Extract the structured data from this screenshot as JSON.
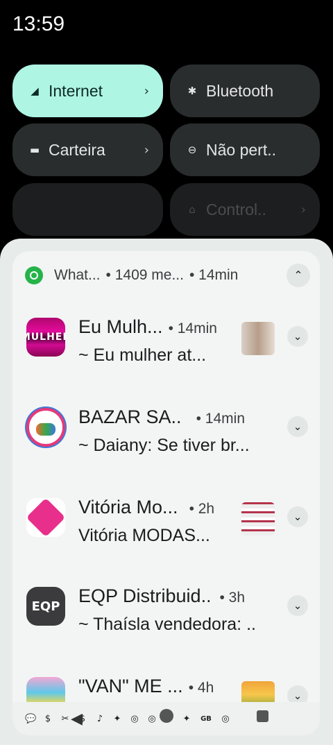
{
  "status_bar": {
    "time": "13:59"
  },
  "quick_settings": {
    "tiles": [
      {
        "label": "Internet",
        "icon": "signal-icon",
        "glyph": "◢",
        "chevron": "›",
        "state": "active"
      },
      {
        "label": "Bluetooth",
        "icon": "bluetooth-icon",
        "glyph": "✱",
        "chevron": "",
        "state": "off"
      },
      {
        "label": "Carteira",
        "icon": "wallet-icon",
        "glyph": "▬",
        "chevron": "›",
        "state": "off"
      },
      {
        "label": "Não pert..",
        "icon": "do-not-disturb-icon",
        "glyph": "⊖",
        "chevron": "",
        "state": "off"
      },
      {
        "label": "",
        "icon": "",
        "glyph": "",
        "chevron": "",
        "state": "dim"
      },
      {
        "label": "Control..",
        "icon": "home-icon",
        "glyph": "⌂",
        "chevron": "›",
        "state": "dim"
      }
    ]
  },
  "notification_group": {
    "app": "What...",
    "count": "• 1409 me...",
    "time": "• 14min",
    "collapse_glyph": "⌃",
    "items": [
      {
        "title": "Eu Mulh...",
        "time": "• 14min",
        "body": "~ Eu mulher at...",
        "avatar_text": "MULHER",
        "avatar_class": "av-mulher",
        "thumb_class": "th-1"
      },
      {
        "title": "BAZAR  SA...",
        "time": "• 14min",
        "body": "~ Daiany: Se tiver br...",
        "avatar_text": "",
        "avatar_class": "av-bazar",
        "thumb_class": ""
      },
      {
        "title": "Vitória Mo...",
        "time": "• 2h",
        "body": "Vitória MODAS...",
        "avatar_text": "",
        "avatar_class": "av-vitoria",
        "thumb_class": "th-2"
      },
      {
        "title": "EQP Distribuid...",
        "time": "• 3h",
        "body": "~ Thaísla vendedora: ..",
        "avatar_text": "EQP",
        "avatar_class": "av-eqp",
        "thumb_class": ""
      },
      {
        "title": "\"VAN\" ME ...",
        "time": "• 4h",
        "body": "",
        "avatar_text": "",
        "avatar_class": "av-van",
        "thumb_class": "th-3"
      }
    ],
    "expand_glyph": "⌄"
  },
  "status_icons": [
    "💬",
    "$",
    "✂",
    "$",
    "♪",
    "✦",
    "◎",
    "◎",
    "⚑",
    "✦",
    "GB",
    "◎"
  ],
  "nav_bar": {
    "back": "◀"
  }
}
